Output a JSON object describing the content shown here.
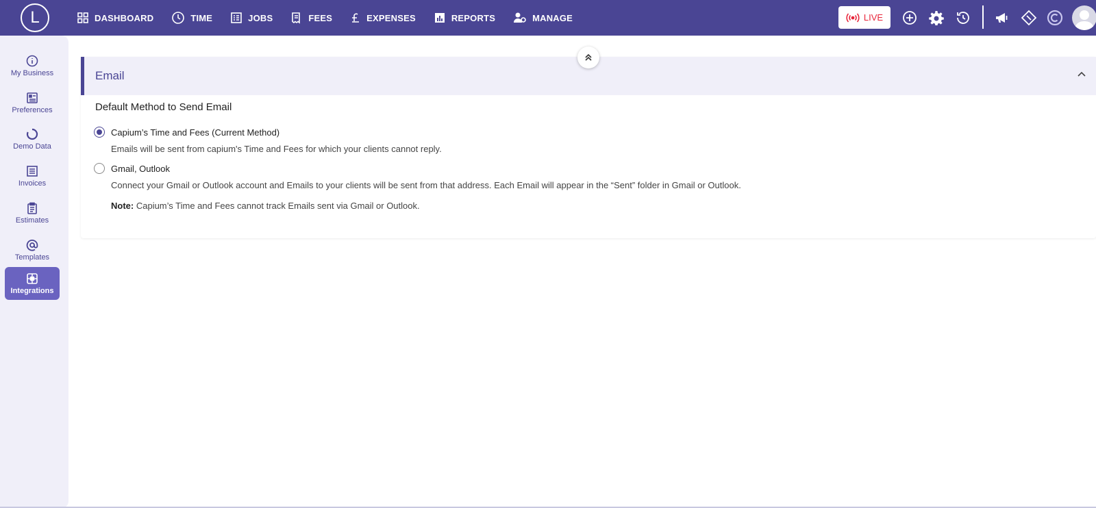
{
  "app": {
    "logo_letter": "L"
  },
  "nav": [
    {
      "label": "DASHBOARD",
      "icon": "grid-icon"
    },
    {
      "label": "TIME",
      "icon": "clock-icon"
    },
    {
      "label": "JOBS",
      "icon": "list-icon"
    },
    {
      "label": "FEES",
      "icon": "receipt-icon"
    },
    {
      "label": "EXPENSES",
      "icon": "pound-icon"
    },
    {
      "label": "REPORTS",
      "icon": "bar-chart-icon"
    },
    {
      "label": "MANAGE",
      "icon": "people-gear-icon"
    }
  ],
  "topbar": {
    "live_label": "LIVE"
  },
  "sidebar": {
    "items": [
      {
        "label": "My Business",
        "icon": "info-icon",
        "active": false
      },
      {
        "label": "Preferences",
        "icon": "preferences-icon",
        "active": false
      },
      {
        "label": "Demo Data",
        "icon": "refresh-icon",
        "active": false
      },
      {
        "label": "Invoices",
        "icon": "invoice-icon",
        "active": false
      },
      {
        "label": "Estimates",
        "icon": "clipboard-icon",
        "active": false
      },
      {
        "label": "Templates",
        "icon": "at-icon",
        "active": false
      },
      {
        "label": "Integrations",
        "icon": "integrations-icon",
        "active": true
      }
    ]
  },
  "email_panel": {
    "title": "Email",
    "section_title": "Default Method to Send Email",
    "options": [
      {
        "label": "Capium’s Time and Fees (Current Method)",
        "checked": true,
        "description": "Emails will be sent from capium's Time and Fees for which your clients cannot reply."
      },
      {
        "label": "Gmail, Outlook",
        "checked": false,
        "description": "Connect your Gmail or Outlook account and Emails to your clients will be sent from that address. Each Email will appear in the “Sent” folder in Gmail or Outlook."
      }
    ],
    "note_label": "Note:",
    "note_text": "Capium’s Time and Fees cannot track Emails sent via Gmail or Outlook."
  },
  "colors": {
    "primary": "#4a4594",
    "sidebar_bg": "#f0eff9",
    "active": "#6a63c0",
    "live": "#e8263b"
  }
}
